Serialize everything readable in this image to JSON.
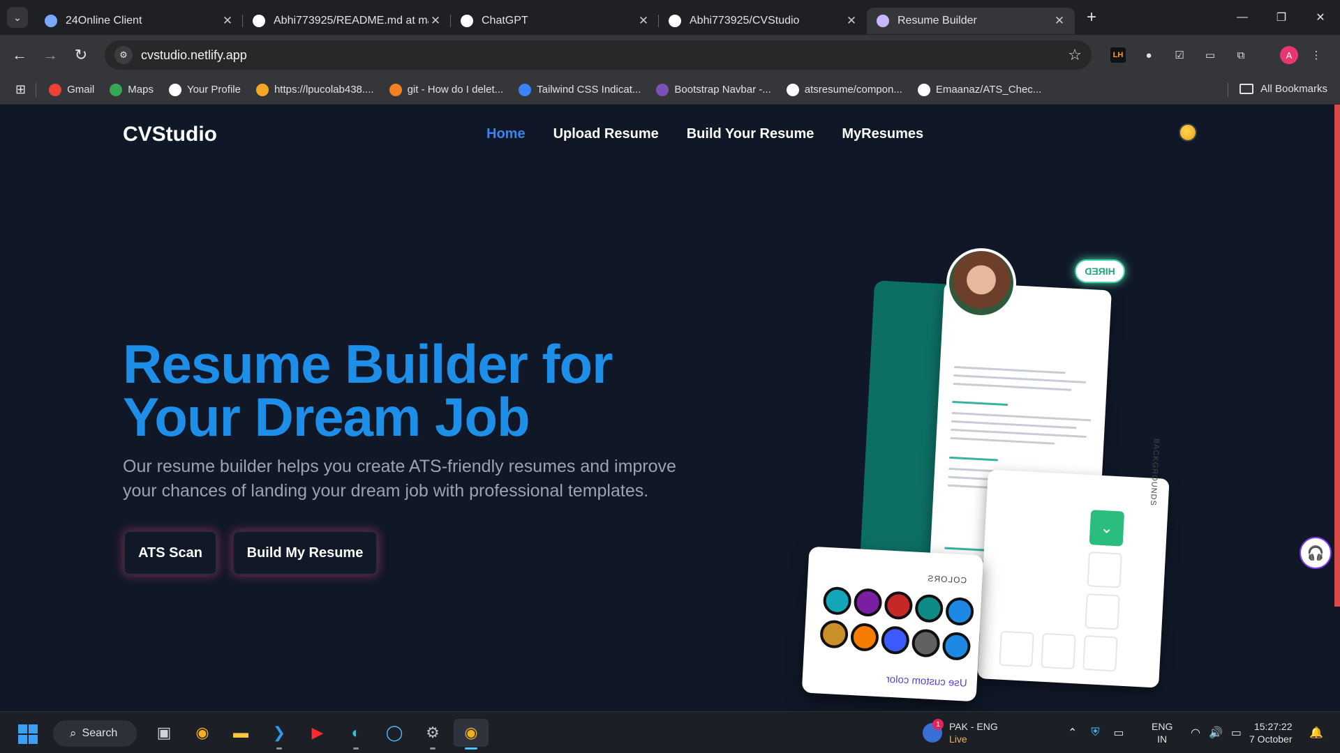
{
  "browser": {
    "tabs": [
      {
        "title": "24Online Client",
        "color": "#7aa7ff",
        "active": false
      },
      {
        "title": "Abhi773925/README.md at ma",
        "color": "#ffffff",
        "active": false
      },
      {
        "title": "ChatGPT",
        "color": "#ffffff",
        "active": false
      },
      {
        "title": "Abhi773925/CVStudio",
        "color": "#ffffff",
        "active": false
      },
      {
        "title": "Resume Builder",
        "color": "#c9b6ff",
        "active": true
      }
    ],
    "url": "cvstudio.netlify.app",
    "bookmarks": [
      {
        "label": "Gmail",
        "color": "#ea4335"
      },
      {
        "label": "Maps",
        "color": "#34a853"
      },
      {
        "label": "Your Profile",
        "color": "#ffffff"
      },
      {
        "label": "https://lpucolab438....",
        "color": "#f5a623"
      },
      {
        "label": "git - How do I delet...",
        "color": "#f48024"
      },
      {
        "label": "Tailwind CSS Indicat...",
        "color": "#3b82f6"
      },
      {
        "label": "Bootstrap Navbar -...",
        "color": "#7952b3"
      },
      {
        "label": "atsresume/compon...",
        "color": "#ffffff"
      },
      {
        "label": "Emaanaz/ATS_Chec...",
        "color": "#ffffff"
      }
    ],
    "all_bookmarks": "All Bookmarks",
    "profile_initial": "A",
    "lighthouse_label": "LH"
  },
  "site": {
    "brand": "CVStudio",
    "nav": [
      {
        "label": "Home",
        "active": true
      },
      {
        "label": "Upload Resume",
        "active": false
      },
      {
        "label": "Build Your Resume",
        "active": false
      },
      {
        "label": "MyResumes",
        "active": false
      }
    ],
    "hero": {
      "title_line1": "Resume Builder for",
      "title_line2": "Your Dream Job",
      "subtitle": "Our resume builder helps you create ATS-friendly resumes and improve your chances of landing your dream job with professional templates.",
      "ats_button": "ATS Scan",
      "build_button": "Build My Resume"
    },
    "illustration": {
      "badge": "HIRED",
      "colors_label": "COLORS",
      "custom_color": "Use custom color",
      "backgrounds_label": "BACKGROUNDS",
      "swatches": [
        "#12a6b8",
        "#7b1fa2",
        "#c62828",
        "#0f8a87",
        "#1e88e5",
        "#c9902a",
        "#f57c00",
        "#3d5afe",
        "#616161",
        "#1e88e5"
      ]
    },
    "accent_color": "#1e8fe8"
  },
  "taskbar": {
    "search_label": "Search",
    "weather_title": "PAK - ENG",
    "weather_sub": "Live",
    "notification_count": "1",
    "lang_top": "ENG",
    "lang_bottom": "IN",
    "time": "15:27:22",
    "date": "7 October"
  }
}
